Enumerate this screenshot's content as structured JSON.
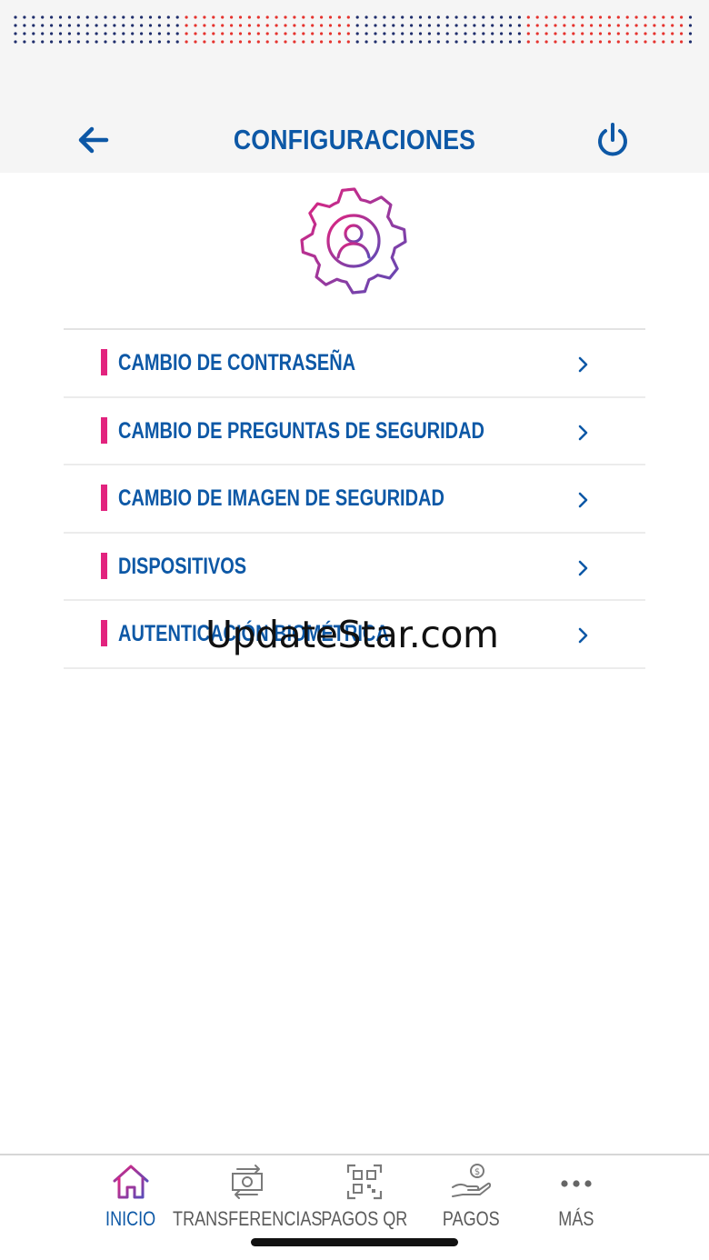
{
  "header": {
    "title": "CONFIGURACIONES",
    "back_icon": "arrow-left-icon",
    "power_icon": "power-icon"
  },
  "colors": {
    "brand_blue": "#0d58a6",
    "accent_pink": "#e2237e",
    "accent_purple": "#7b4bb3",
    "dot_navy": "#1e2d6b",
    "dot_red": "#e5322d"
  },
  "hero": {
    "icon": "gear-user-icon"
  },
  "menu": {
    "items": [
      {
        "label": "CAMBIO DE CONTRASEÑA"
      },
      {
        "label": "CAMBIO DE PREGUNTAS DE SEGURIDAD"
      },
      {
        "label": "CAMBIO DE IMAGEN DE SEGURIDAD"
      },
      {
        "label": "DISPOSITIVOS"
      },
      {
        "label": "AUTENTICACIÓN BIOMÉTRICA"
      }
    ]
  },
  "watermark": "UpdateStar.com",
  "tabbar": {
    "tabs": [
      {
        "label": "INICIO",
        "icon": "home-icon",
        "active": true
      },
      {
        "label": "TRANSFERENCIAS",
        "icon": "money-transfer-icon",
        "active": false
      },
      {
        "label": "PAGOS QR",
        "icon": "qr-code-icon",
        "active": false
      },
      {
        "label": "PAGOS",
        "icon": "hand-coin-icon",
        "active": false
      },
      {
        "label": "MÁS",
        "icon": "more-dots-icon",
        "active": false
      }
    ]
  }
}
